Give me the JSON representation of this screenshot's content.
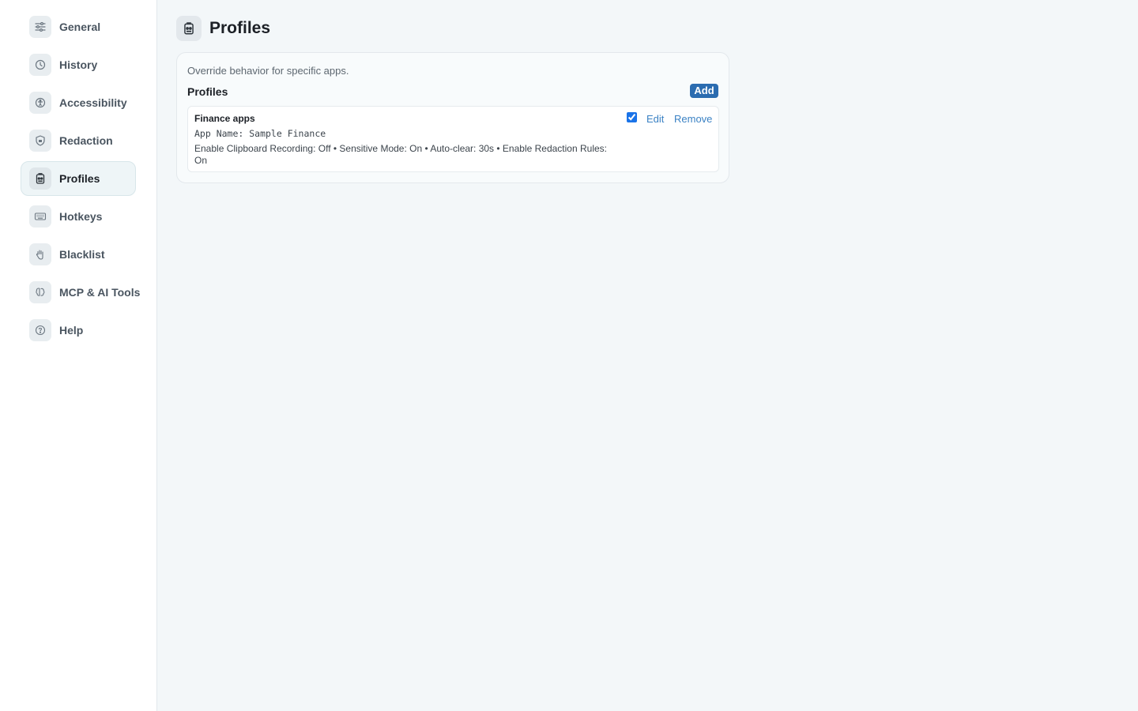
{
  "sidebar": {
    "items": [
      {
        "label": "General",
        "icon": "sliders-icon"
      },
      {
        "label": "History",
        "icon": "clock-icon"
      },
      {
        "label": "Accessibility",
        "icon": "accessibility-icon"
      },
      {
        "label": "Redaction",
        "icon": "shield-icon"
      },
      {
        "label": "Profiles",
        "icon": "id-badge-icon",
        "active": true
      },
      {
        "label": "Hotkeys",
        "icon": "keyboard-icon"
      },
      {
        "label": "Blacklist",
        "icon": "hand-icon"
      },
      {
        "label": "MCP & AI Tools",
        "icon": "brain-icon"
      },
      {
        "label": "Help",
        "icon": "help-icon"
      }
    ]
  },
  "header": {
    "title": "Profiles",
    "icon": "id-badge-icon"
  },
  "panel": {
    "description": "Override behavior for specific apps.",
    "heading": "Profiles",
    "add_label": "Add"
  },
  "profiles": [
    {
      "name": "Finance apps",
      "app": "App Name: Sample Finance",
      "settings": "Enable Clipboard Recording: Off • Sensitive Mode: On • Auto-clear: 30s • Enable Redaction Rules: On",
      "enabled": true,
      "edit_label": "Edit",
      "remove_label": "Remove"
    }
  ],
  "colors": {
    "accent": "#2b6cb0",
    "link": "#3b82c4",
    "background": "#f3f7f9",
    "sidebar": "#ffffff"
  }
}
